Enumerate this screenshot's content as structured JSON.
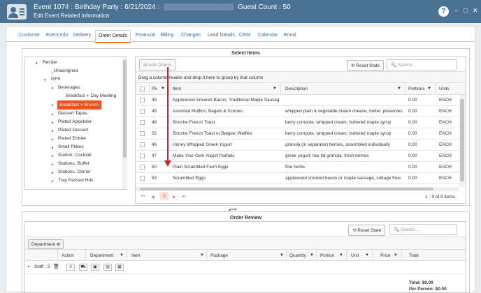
{
  "window": {
    "title_line1_prefix": "Event 1074 : Birthday Party : 6/21/2024 :",
    "title_guest": "Guest Count : 50",
    "title_line2": "Edit Event Related Information",
    "help_glyph": "?",
    "minimize_glyph": "–",
    "maximize_glyph": "□",
    "close_glyph": "✕"
  },
  "tabs": [
    "Customer",
    "Event Info",
    "Delivery",
    "Order Details",
    "Financial",
    "Billing",
    "Changes",
    "Lead Details",
    "CRM",
    "Calendar",
    "Email"
  ],
  "active_tab": "Order Details",
  "tree": {
    "items": [
      {
        "label": "Recipe",
        "caret": "▾"
      },
      {
        "label": "_Unassigned",
        "caret": ""
      },
      {
        "label": "GFS",
        "caret": "▾"
      },
      {
        "label": "Beverages",
        "caret": "▾"
      },
      {
        "label": "Breakfast + Day Meeting",
        "caret": ""
      },
      {
        "label": "Breakfast + Brunch",
        "caret": "▸"
      },
      {
        "label": "Dessert Tapas",
        "caret": "▸"
      },
      {
        "label": "Plated Appetizer",
        "caret": "▸"
      },
      {
        "label": "Plated Dessert",
        "caret": "▸"
      },
      {
        "label": "Plated Entrée",
        "caret": "▸"
      },
      {
        "label": "Small Plates",
        "caret": "▸"
      },
      {
        "label": "Station, Cocktail",
        "caret": "▸"
      },
      {
        "label": "Stations, Buffet",
        "caret": "▸"
      },
      {
        "label": "Stations, Dinner",
        "caret": "▸"
      },
      {
        "label": "Tray Passed Hds",
        "caret": "▸"
      }
    ]
  },
  "select_items": {
    "title": "Select Items",
    "add_orders": "Add Orders",
    "reset_state": "Reset State",
    "search_placeholder": "Search...",
    "group_hint": "Drag a column header and drop it here to group by that column",
    "columns": [
      "Pk",
      "Item",
      "Description",
      "Portions",
      "Units"
    ],
    "rows": [
      {
        "pk": "49",
        "item": "Applewood Smoked Bacon, Traditional Maple Sausag",
        "desc": "",
        "portions": "0.00",
        "units": "EACH"
      },
      {
        "pk": "45",
        "item": "Assorted Muffins, Bagels & Scones",
        "desc": "whipped plain & vegetable cream cheese, butter, preserves",
        "portions": "0.00",
        "units": "EACH"
      },
      {
        "pk": "48",
        "item": "Brioche French Toast",
        "desc": "berry compote, whipped cream, buttered maple syrup",
        "portions": "0.00",
        "units": "EACH"
      },
      {
        "pk": "52",
        "item": "Brioche French Toast or Belgian Waffles",
        "desc": "berry compote, whipped cream, buttered maple syrup",
        "portions": "0.00",
        "units": "EACH"
      },
      {
        "pk": "46",
        "item": "Honey Whipped Greek Yogurt",
        "desc": "granola (in separator) berries, assembled individually",
        "portions": "0.00",
        "units": "EACH"
      },
      {
        "pk": "47",
        "item": "Make Your Own Yogurt Parfaits",
        "desc": "greek yogurt, low fat granola, fresh berries",
        "portions": "0.00",
        "units": "EACH"
      },
      {
        "pk": "50",
        "item": "Plain Scrambled Farm Eggs",
        "desc": "fine herbs",
        "portions": "0.00",
        "units": "EACH"
      },
      {
        "pk": "53",
        "item": "Scrambled Eggs",
        "desc": "applewood smoked bacon or maple sausage, cottage fries",
        "portions": "0.00",
        "units": "EACH"
      }
    ],
    "pager": {
      "first": "⏮",
      "prev": "◀",
      "page": "1",
      "next": "▶",
      "last": "⏭",
      "summary": "1 - 9 of 9 items"
    }
  },
  "order_review": {
    "title": "Order Review",
    "reset_state": "Reset State",
    "search_placeholder": "Search...",
    "group_chip": "Department",
    "columns": [
      "Action",
      "Department",
      "Item",
      "Package",
      "Quantity",
      "Portion",
      "Unit",
      "Price",
      "Total"
    ],
    "group_row": "Staff : 3",
    "total_label": "Total: $0.00",
    "per_person_label": "Per Person: $0.00"
  },
  "colors": {
    "titlebar": "#4a7294",
    "accent": "#e8531f",
    "annotation": "#d41f26"
  }
}
